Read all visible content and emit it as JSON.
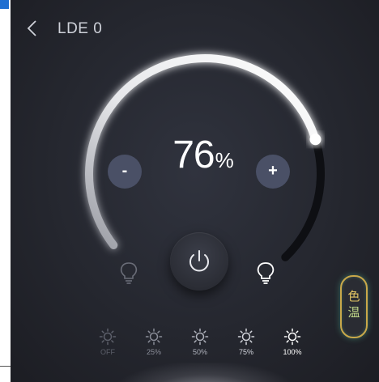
{
  "header": {
    "title": "LDE 0",
    "back_icon": "chevron-left-icon"
  },
  "dial": {
    "value": "76",
    "unit": "%",
    "level_fraction": 0.76,
    "minus_label": "-",
    "plus_label": "+",
    "power_icon": "power-icon",
    "min_icon": "bulb-dim-icon",
    "max_icon": "bulb-bright-icon",
    "colors": {
      "arc_active": "#ffffff",
      "arc_track": "#0e0f13",
      "button_bg": "#4a5066"
    }
  },
  "color_temp": {
    "line1": "色",
    "line2": "温",
    "border_color": "#c9a84a"
  },
  "levels": [
    {
      "label": "OFF",
      "icon": "sun-icon",
      "color": "#5d606b"
    },
    {
      "label": "25%",
      "icon": "sun-icon",
      "color": "#8a8d98"
    },
    {
      "label": "50%",
      "icon": "sun-icon",
      "color": "#aeb1bb"
    },
    {
      "label": "75%",
      "icon": "sun-icon",
      "color": "#d3d5dc"
    },
    {
      "label": "100%",
      "icon": "sun-icon",
      "color": "#ffffff"
    }
  ]
}
